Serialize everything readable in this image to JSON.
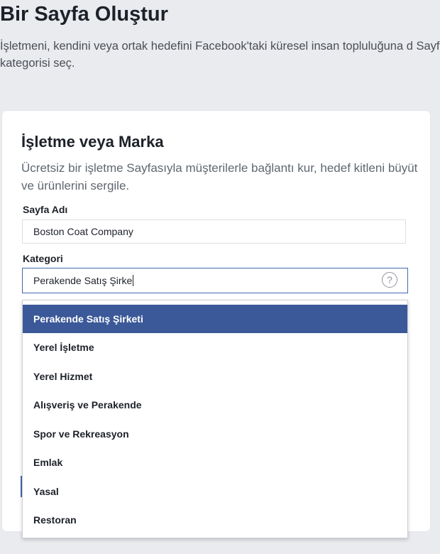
{
  "page": {
    "title": "Bir Sayfa Oluştur",
    "description": "İşletmeni, kendini veya ortak hedefini Facebook'taki küresel insan topluluğuna d Sayfa kategorisi seç."
  },
  "card": {
    "title": "İşletme veya Marka",
    "description": "Ücretsiz bir işletme Sayfasıyla müşterilerle bağlantı kur, hedef kitleni büyüt ve ürünlerini sergile."
  },
  "form": {
    "page_name_label": "Sayfa Adı",
    "page_name_value": "Boston Coat Company",
    "category_label": "Kategori",
    "category_value": "Perakende Satış Şirke"
  },
  "dropdown": {
    "items": [
      "Perakende Satış Şirketi",
      "Yerel İşletme",
      "Yerel Hizmet",
      "Alışveriş ve Perakende",
      "Spor ve Rekreasyon",
      "Emlak",
      "Yasal",
      "Restoran"
    ],
    "selected_index": 0
  },
  "colors": {
    "accent": "#3b5998",
    "focus_border": "#4267b2",
    "background": "#e9ebee"
  },
  "icons": {
    "help": "question-mark-circle-icon"
  }
}
